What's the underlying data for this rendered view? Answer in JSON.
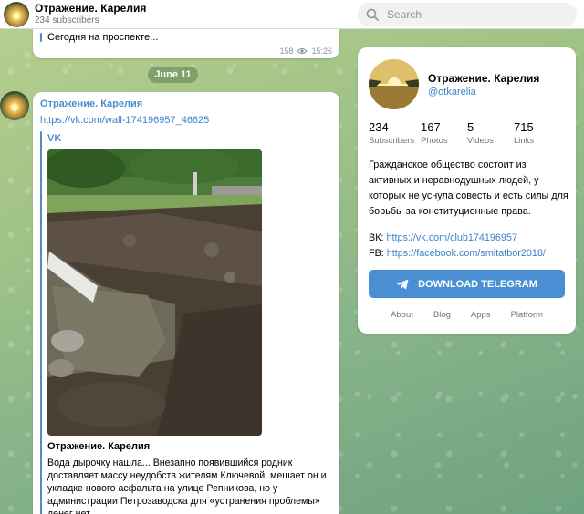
{
  "header": {
    "title": "Отражение. Карелия",
    "subscribers": "234 subscribers",
    "search_placeholder": "Search"
  },
  "messages": [
    {
      "text": "Сегодня на проспекте...",
      "views": "158",
      "time": "15:26"
    }
  ],
  "date_separator": "June 11",
  "post": {
    "channel": "Отражение. Карелия",
    "link": "https://vk.com/wall-174196957_46625",
    "preview": {
      "site": "VK",
      "title": "Отражение. Карелия",
      "description": "Вода дырочку нашла... Внезапно появившийся родник доставляет массу неудобств жителям Ключевой, мешает он и укладке нового асфальта на улице Репникова, но у администрации Петрозаводска для «устранения проблемы» денег нет."
    }
  },
  "channel_card": {
    "name": "Отражение. Карелия",
    "handle": "@otkarelia",
    "stats": [
      {
        "value": "234",
        "label": "Subscribers"
      },
      {
        "value": "167",
        "label": "Photos"
      },
      {
        "value": "5",
        "label": "Videos"
      },
      {
        "value": "715",
        "label": "Links"
      }
    ],
    "description": "Гражданское общество состоит из активных и неравнодушных людей, у которых не уснула совесть и есть силы для борьбы за конституционные права.",
    "vk_label": "ВК:",
    "vk_link": "https://vk.com/club174196957",
    "fb_label": "FB:",
    "fb_link": "https://facebook.com/smitatbor2018/",
    "download_button": "DOWNLOAD TELEGRAM",
    "footer": [
      "About",
      "Blog",
      "Apps",
      "Platform"
    ]
  },
  "colors": {
    "accent": "#4a8fd4",
    "link": "#3a84c8",
    "muted": "#707579"
  }
}
